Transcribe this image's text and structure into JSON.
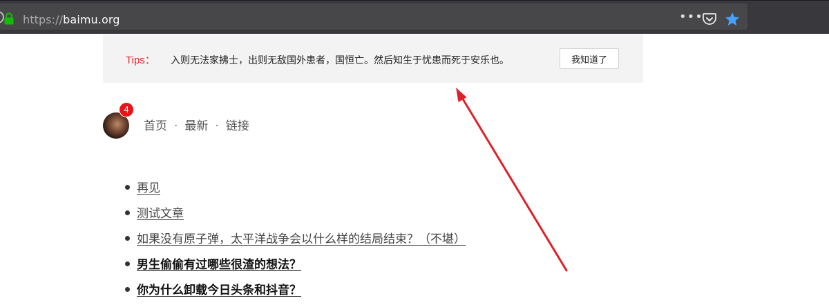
{
  "browser": {
    "url_scheme": "https://",
    "url_host": "baimu.org",
    "more_label": "•••",
    "colors": {
      "toolbar": "#38383d",
      "lock": "#12bc00",
      "star": "#45a1ff"
    }
  },
  "tips": {
    "label": "Tips：",
    "text": "入则无法家拂士，出则无敌国外患者，国恒亡。然后知生于忧患而死于安乐也。",
    "button": "我知道了"
  },
  "header": {
    "badge_count": "4",
    "nav": [
      "首页",
      "最新",
      "链接"
    ],
    "separator": "·"
  },
  "posts": [
    {
      "title": "再见"
    },
    {
      "title": "测试文章"
    },
    {
      "title": "如果没有原子弹，太平洋战争会以什么样的结局结束？（不堪）"
    },
    {
      "title": "男生偷偷有过哪些很渣的想法？"
    },
    {
      "title": "你为什么卸载今日头条和抖音？"
    }
  ],
  "annotation": {
    "color": "#e02028"
  }
}
